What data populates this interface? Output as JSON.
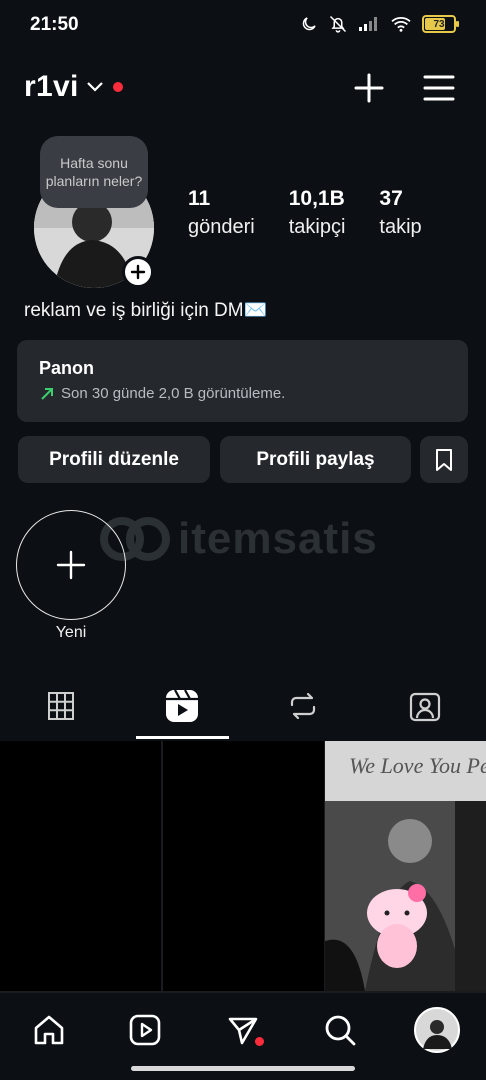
{
  "status_bar": {
    "time": "21:50",
    "battery": "73",
    "battery_level": 0.73
  },
  "header": {
    "username": "r1vi"
  },
  "profile": {
    "note": "Hafta sonu planların neler?",
    "stats": [
      {
        "count": "11",
        "label": "gönderi"
      },
      {
        "count": "10,1B",
        "label": "takipçi"
      },
      {
        "count": "37",
        "label": "takip"
      }
    ],
    "bio": "reklam ve iş birliği için DM✉️"
  },
  "dashboard": {
    "title": "Panon",
    "subtitle": "Son 30 günde 2,0 B görüntüleme."
  },
  "actions": {
    "edit": "Profili düzenle",
    "share": "Profili paylaş"
  },
  "highlights": {
    "new_label": "Yeni"
  },
  "watermark": {
    "brand": "itemsatis"
  },
  "grid_post": {
    "banner_text": "We Love You Pet"
  },
  "colors": {
    "background": "#0c1014",
    "card": "#25292e",
    "accent_red": "#ff2d3c",
    "trend_green": "#3ccf6e"
  }
}
